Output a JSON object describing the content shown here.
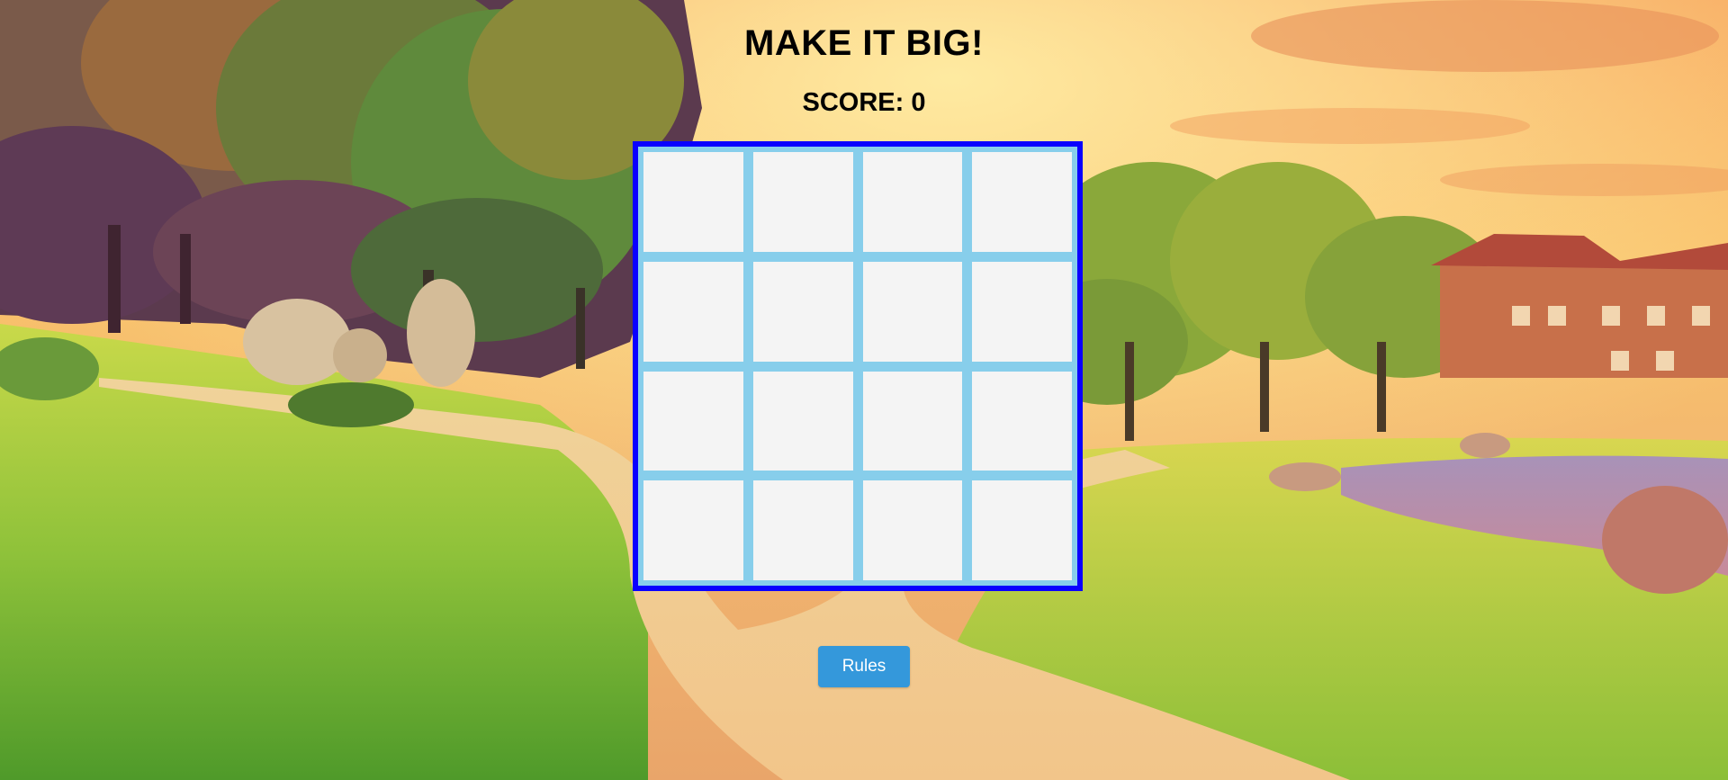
{
  "game": {
    "title": "MAKE IT BIG!",
    "score_label": "SCORE:",
    "score_value": 0,
    "board": {
      "rows": 4,
      "cols": 4,
      "tiles": [
        [
          "",
          "",
          "",
          ""
        ],
        [
          "",
          "",
          "",
          ""
        ],
        [
          "",
          "",
          "",
          ""
        ],
        [
          "",
          "",
          "",
          ""
        ]
      ],
      "border_color": "#0a00ff",
      "grid_color": "#87ceeb",
      "tile_color": "#f4f4f4"
    },
    "rules_button_label": "Rules",
    "rules_button_color": "#3498db"
  }
}
